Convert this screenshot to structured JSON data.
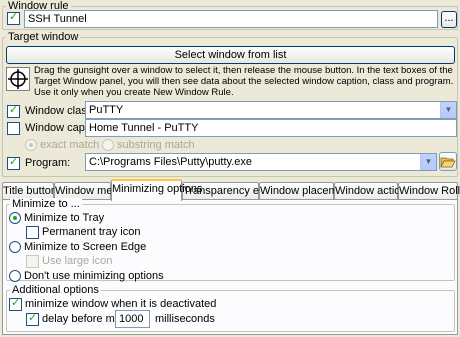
{
  "window_rule": {
    "legend": "Window rule",
    "name_value": "SSH Tunnel",
    "browse_label": "..."
  },
  "target_window": {
    "legend": "Target window",
    "select_button": "Select window from list",
    "help_text": "Drag the gunsight over a window to select it, then release the mouse button. In the text boxes of the Target Window panel, you will then see data about the selected window caption, class and program. Use it only when you create New Window Rule.",
    "class_label": "Window class:",
    "class_value": "PuTTY",
    "caption_label": "Window caption:",
    "caption_value": "Home Tunnel - PuTTY",
    "exact_match": "exact match",
    "substring_match": "substring match",
    "program_label": "Program:",
    "program_value": "C:\\Programs Files\\Putty\\putty.exe"
  },
  "tabs": [
    "Title buttons",
    "Window menu",
    "Minimizing options",
    "Transparency effect",
    "Window placement",
    "Window actions",
    "Window Rollup"
  ],
  "minimize_to": {
    "legend": "Minimize to ...",
    "tray": "Minimize to Tray",
    "permanent_tray_icon": "Permanent tray icon",
    "screen_edge": "Minimize to Screen Edge",
    "use_large_icon": "Use large icon",
    "dont_use": "Don't use minimizing options"
  },
  "additional": {
    "legend": "Additional options",
    "minimize_deactivated": "minimize window when it is deactivated",
    "delay_label": "delay before minimize",
    "delay_value": "1000",
    "milliseconds": "milliseconds"
  }
}
